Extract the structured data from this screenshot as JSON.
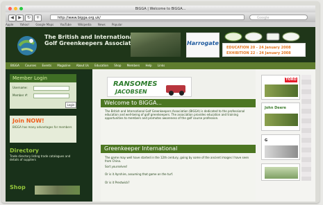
{
  "browser": {
    "title": "BIGGA | Welcome to BIGGA...",
    "address": "http://www.bigga.org.uk/",
    "search_placeholder": "Google",
    "bookmarks": [
      "Apple",
      "Yahoo!",
      "Google Maps",
      "YouTube",
      "Wikipedia",
      "News",
      "Popular"
    ]
  },
  "header": {
    "org_name": "The British and International Golf Greenkeepers Association",
    "event_brand": "Harrogate",
    "event_line1": "EDUCATION 20 - 24 January 2008",
    "event_line2": "EXHIBITION 22 - 24 January 2008"
  },
  "nav": {
    "items": [
      "BIGGA",
      "Courses",
      "Events",
      "Magazine",
      "About Us",
      "Education",
      "Shop",
      "Members",
      "Help",
      "Links"
    ]
  },
  "sidebar": {
    "login_title": "Member Login",
    "username_label": "Username:",
    "member_label": "Member #:",
    "login_button": "Login",
    "join_title": "Join NOW!",
    "join_text": "BIGGA has many advantages for members",
    "directory_title": "Directory",
    "directory_text": "Trade directory listing trade catalogues and details of suppliers",
    "shop_title": "Shop"
  },
  "banner": {
    "brand": "RANSOMES",
    "brand2": "JACOBSEN"
  },
  "main": {
    "welcome_title": "Welcome to BIGGA...",
    "welcome_text": "The British and International Golf Greenkeepers Association (BIGGA) is dedicated to the professional education and well-being of golf greenkeepers. The association provides education and training opportunities to members and promotes awareness of the golf course profession.",
    "intl_title": "Greenkeeper International",
    "intl_text_1": "The game may well have started in the 12th century, going by some of the ancient images I have seen from China.",
    "intl_text_2": "Sort yourselves!",
    "intl_text_3": "Or is it Ayrshire, assuming that game on the turf.",
    "intl_text_4": "Or is it Prestwick?"
  },
  "ads": {
    "toro": "TORO",
    "deere": "John Deere",
    "g_brand": "G"
  },
  "colors": {
    "header_bg": "#1f3619",
    "nav_bg": "#5f7d2e",
    "section_green": "#4c7622",
    "join_orange": "#ee5e1c"
  }
}
